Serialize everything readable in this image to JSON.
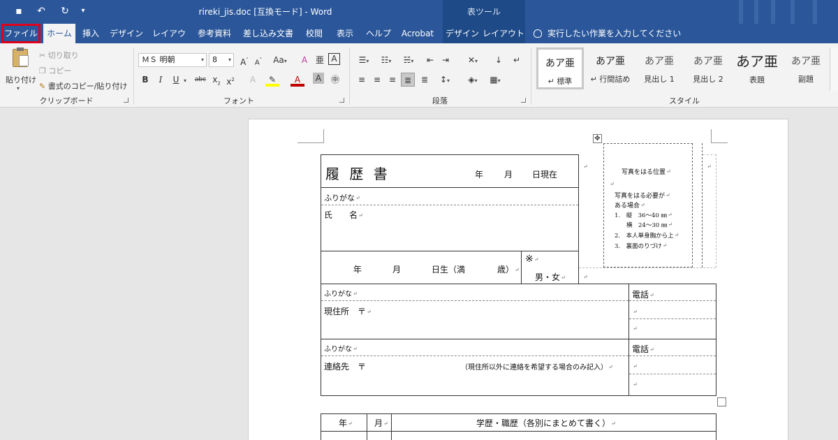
{
  "titlebar": {
    "doc_title": "rireki_jis.doc [互換モード]  -  Word",
    "table_tools": "表ツール"
  },
  "tabs": [
    {
      "label": "ファイル"
    },
    {
      "label": "ホーム"
    },
    {
      "label": "挿入"
    },
    {
      "label": "デザイン"
    },
    {
      "label": "レイアウト"
    },
    {
      "label": "参考資料"
    },
    {
      "label": "差し込み文書"
    },
    {
      "label": "校閲"
    },
    {
      "label": "表示"
    },
    {
      "label": "ヘルプ"
    },
    {
      "label": "Acrobat"
    },
    {
      "label": "デザイン"
    },
    {
      "label": "レイアウト"
    }
  ],
  "tell_me": "実行したい作業を入力してください",
  "clipboard": {
    "paste": "貼り付け",
    "cut": "切り取り",
    "copy": "コピー",
    "format_painter": "書式のコピー/貼り付け",
    "label": "クリップボード"
  },
  "font": {
    "name": "ＭＳ 明朝",
    "size": "8",
    "label": "フォント"
  },
  "paragraph": {
    "label": "段落"
  },
  "styles": {
    "label": "スタイル",
    "items": [
      {
        "sample": "あア亜",
        "name": "↵ 標準"
      },
      {
        "sample": "あア亜",
        "name": "↵ 行間詰め"
      },
      {
        "sample": "あア亜",
        "name": "見出し 1"
      },
      {
        "sample": "あア亜",
        "name": "見出し 2"
      },
      {
        "sample": "あア亜",
        "name": "表題"
      },
      {
        "sample": "あア亜",
        "name": "副題"
      }
    ]
  },
  "resume": {
    "title": "履 歴 書",
    "year": "年",
    "month": "月",
    "as_of": "日現在",
    "furigana": "ふりがな",
    "name": "氏　　名",
    "dob_year": "年",
    "dob_month": "月",
    "dob_day": "日生（満",
    "dob_age": "歳）",
    "note_mark": "※",
    "gender": "男・女",
    "photo_title": "写真をはる位置",
    "photo_note1": "写真をはる必要が",
    "photo_note2": "ある場合",
    "photo_li1": "1.　縦　36〜40 ㎜",
    "photo_li1b": "　　横　24〜30 ㎜",
    "photo_li2": "2.　本人単身胸から上",
    "photo_li3": "3.　裏面のりづけ",
    "addr_furigana": "ふりがな",
    "address": "現住所　〒",
    "tel": "電話",
    "contact_furigana": "ふりがな",
    "contact": "連絡先　〒",
    "contact_note": "（現住所以外に連絡を希望する場合のみ記入）",
    "tel2": "電話",
    "hist_year": "年",
    "hist_month": "月",
    "hist_title": "学歴・職歴（各別にまとめて書く）"
  }
}
